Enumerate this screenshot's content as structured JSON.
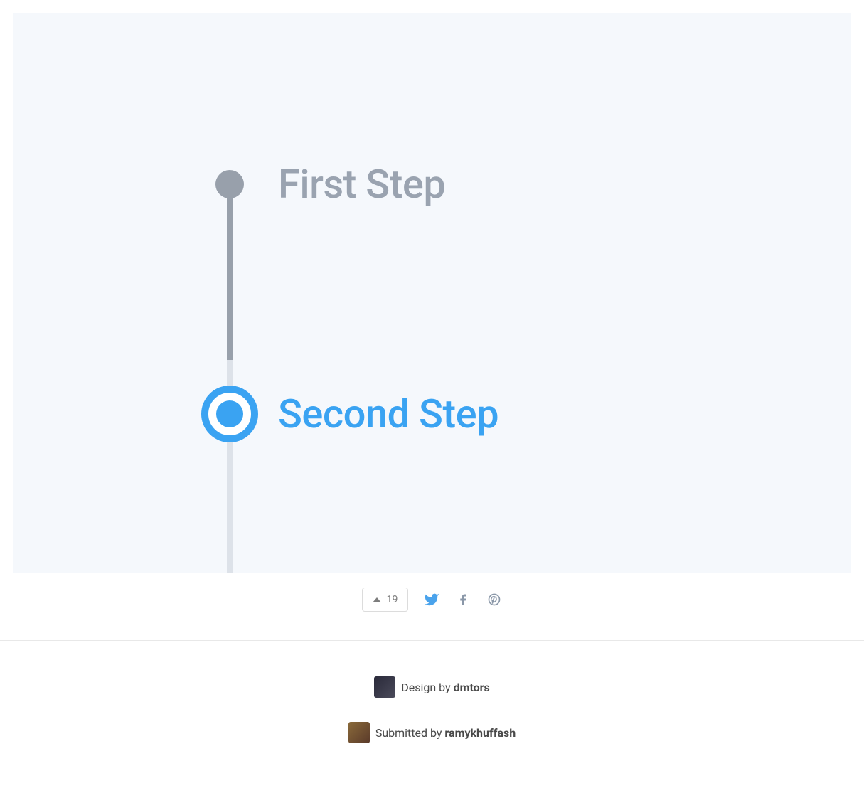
{
  "timeline": {
    "steps": [
      {
        "label": "First Step",
        "active": false
      },
      {
        "label": "Second Step",
        "active": true
      }
    ]
  },
  "actions": {
    "upvote_count": "19"
  },
  "credits": {
    "design_prefix": "Design by ",
    "design_author": "dmtors",
    "submitted_prefix": "Submitted by ",
    "submitted_author": "ramykhuffash"
  },
  "colors": {
    "inactive": "#9aa3b0",
    "active": "#3aa3f2",
    "connector_done": "#98a0ab",
    "connector_pending": "#dde2e9",
    "canvas_bg": "#f5f8fc"
  }
}
